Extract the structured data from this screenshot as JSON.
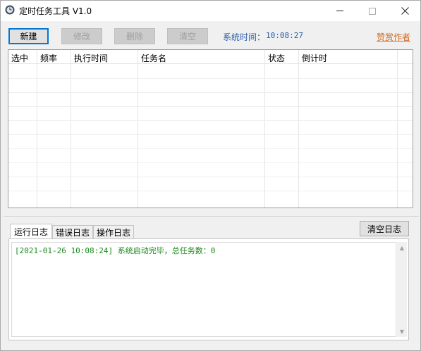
{
  "window": {
    "title": "定时任务工具 V1.0",
    "icon": "clock-icon"
  },
  "toolbar": {
    "new_label": "新建",
    "edit_label": "修改",
    "delete_label": "删除",
    "clear_label": "清空",
    "sys_time_label": "系统时间：",
    "sys_time_value": "10:08:27",
    "praise_label": "赞赏作者"
  },
  "grid": {
    "columns": [
      "选中",
      "频率",
      "执行时间",
      "任务名",
      "状态",
      "倒计时"
    ]
  },
  "log": {
    "tabs": [
      "运行日志",
      "错误日志",
      "操作日志"
    ],
    "active_tab": "运行日志",
    "clear_label": "清空日志",
    "lines": [
      "[2021-01-26 10:08:24] 系统启动完毕，总任务数：0"
    ]
  },
  "colors": {
    "link": "#d2691e",
    "sys_time": "#2b5fa8",
    "log_text": "#1a8a1a"
  }
}
